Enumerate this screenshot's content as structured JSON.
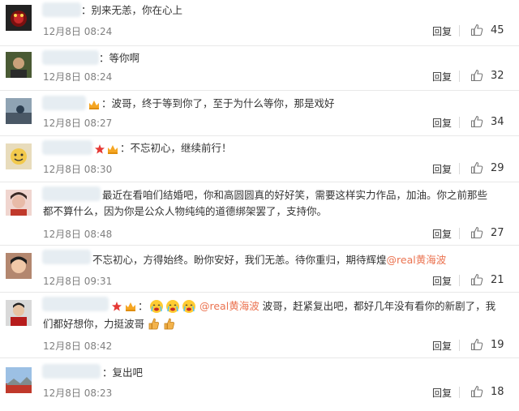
{
  "colors": {
    "mention": "#eb7350",
    "time": "#808080",
    "text": "#333333"
  },
  "comments": [
    {
      "text": "：别来无恙，你在心上",
      "time": "12月8日 08:24",
      "reply": "回复",
      "likes": "45"
    },
    {
      "text": "：等你啊",
      "time": "12月8日 08:24",
      "reply": "回复",
      "likes": "32"
    },
    {
      "text": "：波哥，终于等到你了，至于为什么等你，那是戏好",
      "time": "12月8日 08:27",
      "reply": "回复",
      "likes": "34"
    },
    {
      "text": "：不忘初心，继续前行！",
      "time": "12月8日 08:30",
      "reply": "回复",
      "likes": "29"
    },
    {
      "line1": "最近在看咱们结婚吧，你和高圆圆真的好好笑，需要这样实力作品，加油。你之前那些",
      "line2": "都不算什么，因为你是公众人物纯纯的道德绑架罢了，支持你。",
      "time": "12月8日 08:48",
      "reply": "回复",
      "likes": "27"
    },
    {
      "text_before": "不忘初心，方得始终。盼你安好，我们无恙。待你重归，期待辉煌",
      "mention": "@real黄海波",
      "time": "12月8日 09:31",
      "reply": "回复",
      "likes": "21"
    },
    {
      "mention": "@real黄海波",
      "line1_after": " 波哥，赶紧复出吧，都好几年没有看你的新剧了，我",
      "line2": "们都好想你，力挺波哥",
      "time": "12月8日 08:42",
      "reply": "回复",
      "likes": "19"
    },
    {
      "text": "：复出吧",
      "time": "12月8日 08:23",
      "reply": "回复",
      "likes": "18"
    }
  ]
}
